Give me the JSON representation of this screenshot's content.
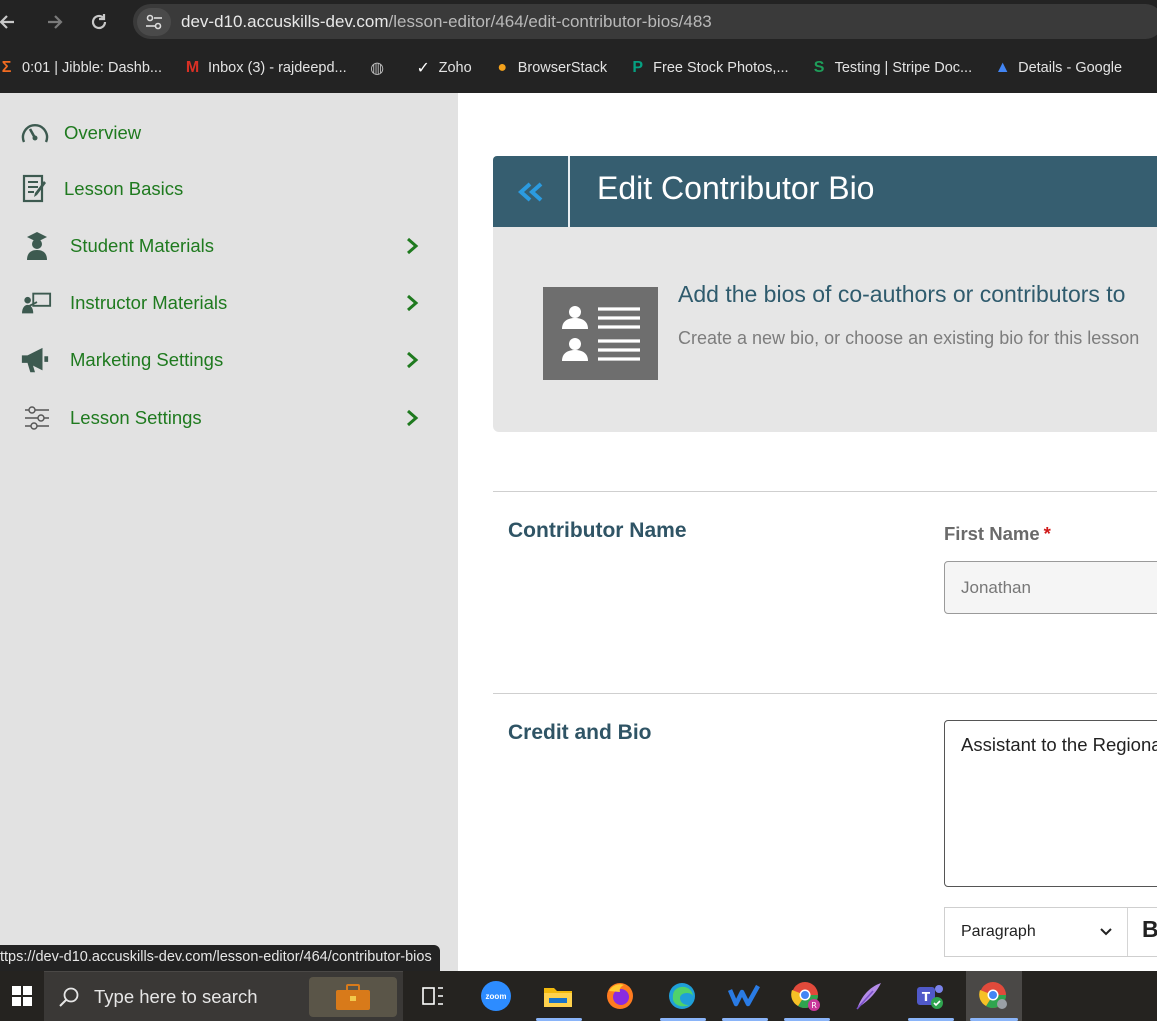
{
  "browser": {
    "url_host": "dev-d10.accuskills-dev.com",
    "url_path": "/lesson-editor/464/edit-contributor-bios/483"
  },
  "bookmarks": [
    {
      "label": "0:01 | Jibble: Dashb...",
      "icon": "jibble-icon",
      "color": "#f26b21"
    },
    {
      "label": "Inbox (3) - rajdeepd...",
      "icon": "gmail-icon",
      "color": "#d93025"
    },
    {
      "label": "",
      "icon": "globe-icon",
      "color": "#bdbdbd"
    },
    {
      "label": "Zoho",
      "icon": "zoho-icon",
      "color": "#ffffff"
    },
    {
      "label": "BrowserStack",
      "icon": "browserstack-icon",
      "color": "#f4a21c"
    },
    {
      "label": "Free Stock Photos,...",
      "icon": "pexels-icon",
      "color": "#05a081"
    },
    {
      "label": "Testing | Stripe Doc...",
      "icon": "stripe-s-icon",
      "color": "#1e9e5a"
    },
    {
      "label": "Details - Google",
      "icon": "google-drive-icon",
      "color": "#4285f4"
    }
  ],
  "sidebar": {
    "items": [
      {
        "label": "Overview",
        "icon": "speedometer-icon",
        "has_chevron": false
      },
      {
        "label": "Lesson Basics",
        "icon": "document-edit-icon",
        "has_chevron": false
      },
      {
        "label": "Student Materials",
        "icon": "graduate-icon",
        "has_chevron": true
      },
      {
        "label": "Instructor Materials",
        "icon": "teacher-board-icon",
        "has_chevron": true
      },
      {
        "label": "Marketing Settings",
        "icon": "megaphone-icon",
        "has_chevron": true
      },
      {
        "label": "Lesson Settings",
        "icon": "sliders-icon",
        "has_chevron": true
      }
    ],
    "accent": "#1f7a1f"
  },
  "page": {
    "title": "Edit Contributor Bio",
    "info_title": "Add the bios of co-authors or contributors to",
    "info_subtitle": "Create a new bio, or choose an existing bio for this lesson",
    "header_color": "#365e70"
  },
  "form": {
    "contributor_name_label": "Contributor Name",
    "first_name_label": "First Name",
    "required_mark": "*",
    "first_name_value": "Jonathan",
    "credit_bio_label": "Credit and Bio",
    "bio_value": "Assistant to the Regional Manager",
    "format_select": "Paragraph",
    "bold_label": "B"
  },
  "status_bar": {
    "hover_url": "ttps://dev-d10.accuskills-dev.com/lesson-editor/464/contributor-bios"
  },
  "taskbar": {
    "search_placeholder": "Type here to search",
    "zoom_label": "zoom",
    "apps": [
      "task-view-icon",
      "zoom-icon",
      "file-explorer-icon",
      "firefox-icon",
      "edge-icon",
      "w-app-icon",
      "chrome-profile-icon",
      "quill-icon",
      "teams-icon",
      "chrome-icon"
    ]
  }
}
